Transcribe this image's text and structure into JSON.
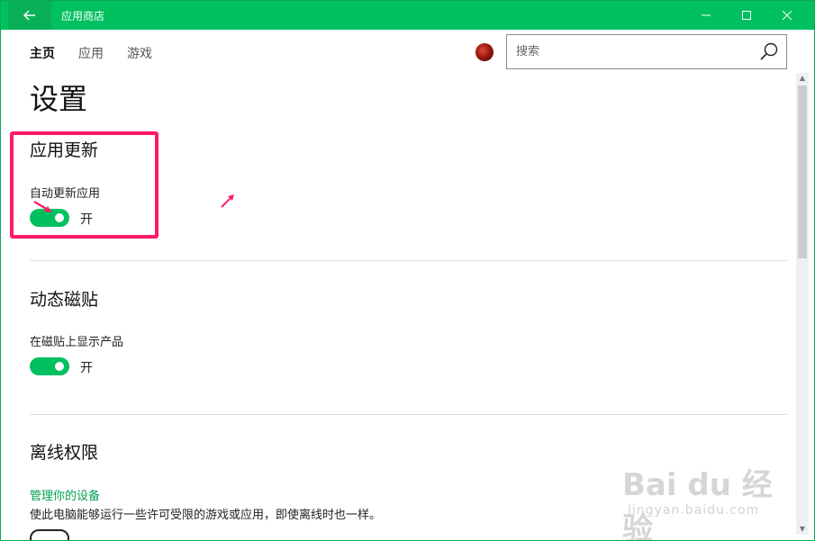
{
  "window": {
    "title": "应用商店",
    "accent_color": "#00c060"
  },
  "nav": {
    "tabs": [
      {
        "label": "主页",
        "active": true
      },
      {
        "label": "应用",
        "active": false
      },
      {
        "label": "游戏",
        "active": false
      }
    ]
  },
  "search": {
    "placeholder": "搜索"
  },
  "page": {
    "title": "设置"
  },
  "sections": {
    "app_updates": {
      "title": "应用更新",
      "setting_label": "自动更新应用",
      "toggle_state": "开",
      "toggle_on": true
    },
    "live_tiles": {
      "title": "动态磁贴",
      "setting_label": "在磁贴上显示产品",
      "toggle_state": "开",
      "toggle_on": true
    },
    "offline": {
      "title": "离线权限",
      "link": "管理你的设备",
      "description": "使此电脑能够运行一些许可受限的游戏或应用，即使离线时也一样。"
    }
  },
  "icons": {
    "back": "back-arrow-icon",
    "minimize": "minimize-icon",
    "maximize": "maximize-icon",
    "close": "close-icon",
    "search": "search-icon",
    "avatar": "user-avatar"
  },
  "annotation": {
    "highlight_color": "#ff1b66"
  },
  "watermark": {
    "brand": "Bai du 经验",
    "url": "jingyan.baidu.com"
  }
}
